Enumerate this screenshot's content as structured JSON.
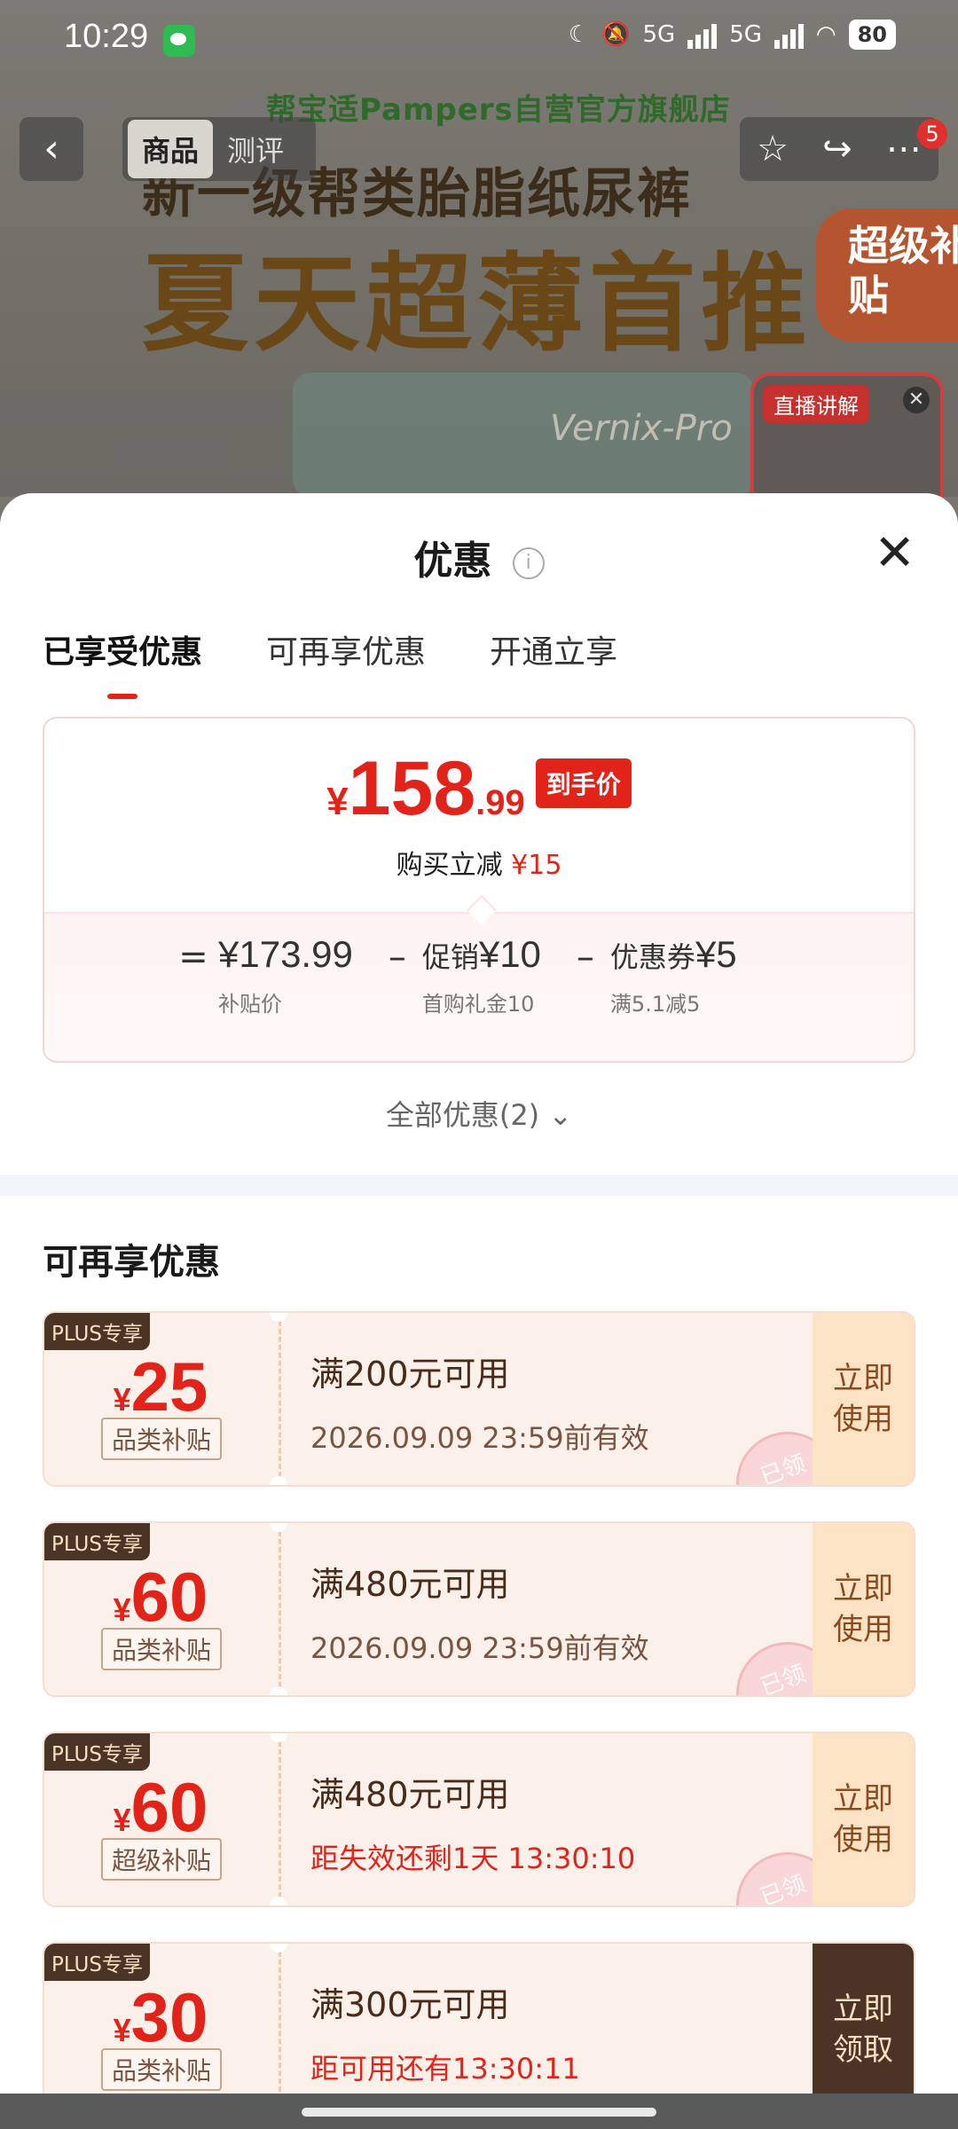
{
  "status_bar": {
    "time": "10:29",
    "network_1": "5G",
    "network_2": "5G",
    "battery": "80"
  },
  "product_header": {
    "store_name": "帮宝适Pampers自营官方旗舰店",
    "headline_1": "新一级帮类胎脂纸尿裤",
    "headline_2": "夏天超薄首推",
    "badge": "超级补贴",
    "pack_text": "Vernix-Pro",
    "tabs": [
      "商品",
      "测评"
    ],
    "notification_count": "5",
    "live_tag": "直播讲解"
  },
  "sheet": {
    "title": "优惠",
    "tabs": [
      "已享受优惠",
      "可再享优惠",
      "开通立享"
    ],
    "price": {
      "currency": "¥",
      "integer": "158",
      "decimal": ".99",
      "pill": "到手价",
      "reduce_label": "购买立减",
      "reduce_value": "¥15"
    },
    "formula": {
      "eq": "=",
      "minus": "–",
      "items": [
        {
          "value": "¥173.99",
          "label": "",
          "sub": "补贴价"
        },
        {
          "value": "¥10",
          "label": "促销",
          "sub": "首购礼金10"
        },
        {
          "value": "¥5",
          "label": "优惠券",
          "sub": "满5.1减5"
        }
      ]
    },
    "all_offers": "全部优惠(2)",
    "section_title": "可再享优惠",
    "coupons": [
      {
        "plus": "PLUS专享",
        "amount": "25",
        "category": "品类补贴",
        "condition": "满200元可用",
        "validity": "2026.09.09 23:59前有效",
        "stamp": "已领",
        "action": "立即使用"
      },
      {
        "plus": "PLUS专享",
        "amount": "60",
        "category": "品类补贴",
        "condition": "满480元可用",
        "validity": "2026.09.09 23:59前有效",
        "stamp": "已领",
        "action": "立即使用"
      },
      {
        "plus": "PLUS专享",
        "amount": "60",
        "category": "超级补贴",
        "condition": "满480元可用",
        "validity": "距失效还剩1天 13:30:10",
        "stamp": "已领",
        "action": "立即使用"
      },
      {
        "plus": "PLUS专享",
        "amount": "30",
        "category": "品类补贴",
        "condition": "满300元可用",
        "validity": "距可用还有13:30:11",
        "stamp": "",
        "action": "立即领取"
      }
    ]
  },
  "colors": {
    "accent_red": "#e2231a",
    "coupon_bg": "#fbf1ea",
    "plus_bg": "#4a3426"
  }
}
